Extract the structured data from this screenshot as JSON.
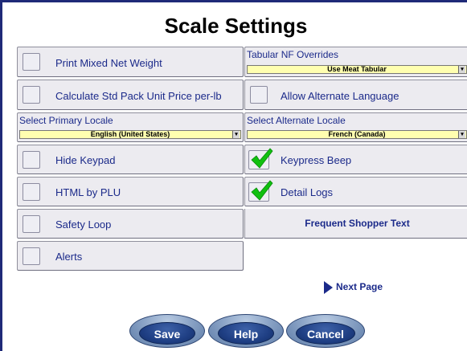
{
  "page": {
    "title": "Scale Settings"
  },
  "left_column": {
    "print_mixed_net_weight": "Print Mixed Net Weight",
    "calculate_std_pack": "Calculate Std Pack Unit Price per-lb",
    "select_primary_locale": {
      "label": "Select Primary Locale",
      "value": "English (United States)"
    },
    "hide_keypad": "Hide Keypad",
    "html_by_plu": "HTML by PLU",
    "safety_loop": "Safety Loop",
    "alerts": "Alerts"
  },
  "right_column": {
    "tabular_nf_overrides": {
      "label": "Tabular NF Overrides",
      "value": "Use Meat Tabular"
    },
    "allow_alternate_language": "Allow Alternate Language",
    "select_alternate_locale": {
      "label": "Select Alternate Locale",
      "value": "French (Canada)"
    },
    "keypress_beep": {
      "label": "Keypress Beep",
      "checked": true
    },
    "detail_logs": {
      "label": "Detail Logs",
      "checked": true
    },
    "frequent_shopper_text": "Frequent Shopper Text"
  },
  "nav": {
    "next_page": "Next Page"
  },
  "buttons": {
    "save": "Save",
    "help": "Help",
    "cancel": "Cancel"
  },
  "colors": {
    "frame_border": "#1f2a78",
    "label_text": "#1b2a8a",
    "dropdown_fill": "#ffffb0",
    "check_green": "#10c010",
    "button_blue": "#1f3f84"
  }
}
